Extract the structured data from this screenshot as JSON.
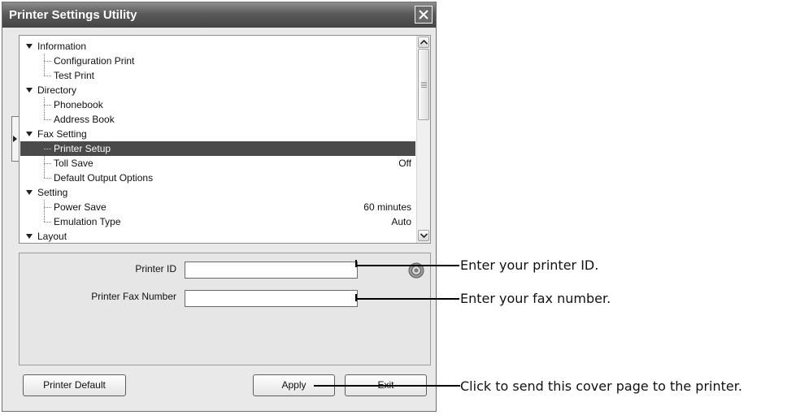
{
  "window": {
    "title": "Printer Settings Utility"
  },
  "tree": {
    "rows": [
      {
        "type": "parent",
        "label": "Information",
        "value": ""
      },
      {
        "type": "child",
        "label": "Configuration Print",
        "value": ""
      },
      {
        "type": "child",
        "label": "Test Print",
        "value": ""
      },
      {
        "type": "parent",
        "label": "Directory",
        "value": ""
      },
      {
        "type": "child",
        "label": "Phonebook",
        "value": ""
      },
      {
        "type": "child",
        "label": "Address Book",
        "value": ""
      },
      {
        "type": "parent",
        "label": "Fax Setting",
        "value": ""
      },
      {
        "type": "child",
        "label": "Printer Setup",
        "value": "",
        "selected": true
      },
      {
        "type": "child",
        "label": "Toll Save",
        "value": "Off"
      },
      {
        "type": "child",
        "label": "Default Output Options",
        "value": ""
      },
      {
        "type": "parent",
        "label": "Setting",
        "value": ""
      },
      {
        "type": "child",
        "label": "Power Save",
        "value": "60 minutes"
      },
      {
        "type": "child",
        "label": "Emulation Type",
        "value": "Auto"
      },
      {
        "type": "parent",
        "label": "Layout",
        "value": ""
      }
    ]
  },
  "form": {
    "printer_id_label": "Printer ID",
    "printer_id_value": "",
    "fax_number_label": "Printer Fax Number",
    "fax_number_value": ""
  },
  "buttons": {
    "printer_default": "Printer Default",
    "apply": "Apply",
    "exit": "Exit"
  },
  "callouts": {
    "printer_id": "Enter your printer ID.",
    "fax_number": "Enter your fax number.",
    "apply": "Click to send this cover page to the printer."
  },
  "icons": {
    "close": "close-icon",
    "help": "help-icon",
    "expand": "triangle-down-icon"
  },
  "colors": {
    "title_bar": "#5a5a5a",
    "selection": "#4a4a4a",
    "window_bg": "#e9e9e9"
  }
}
